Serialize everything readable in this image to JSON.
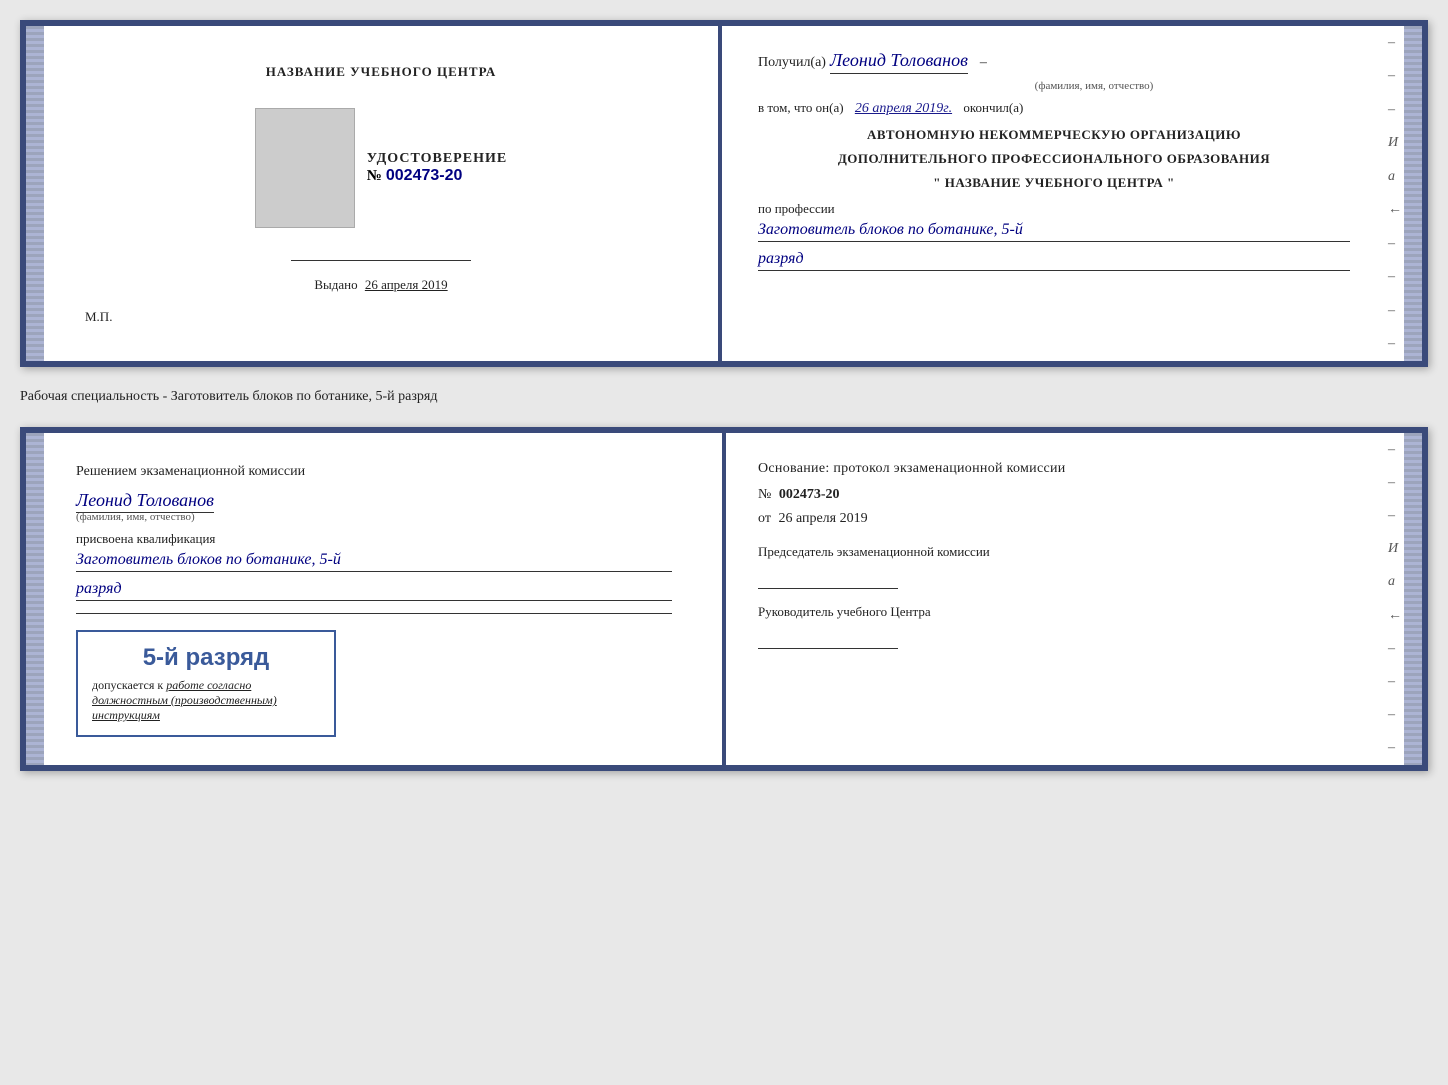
{
  "page": {
    "background": "#e8e8e8"
  },
  "certificate": {
    "left": {
      "title": "НАЗВАНИЕ УЧЕБНОГО ЦЕНТРА",
      "photo_alt": "фото",
      "udostoverenie_label": "УДОСТОВЕРЕНИЕ",
      "number_prefix": "№",
      "number": "002473-20",
      "issued_label": "Выдано",
      "issued_date": "26 апреля 2019",
      "mp_label": "М.П."
    },
    "right": {
      "received_prefix": "Получил(а)",
      "recipient_name": "Леонид Толованов",
      "fio_label": "(фамилия, имя, отчество)",
      "in_that_prefix": "в том, что он(а)",
      "in_that_date": "26 апреля 2019г.",
      "completed_suffix": "окончил(а)",
      "org_line1": "АВТОНОМНУЮ НЕКОММЕРЧЕСКУЮ ОРГАНИЗАЦИЮ",
      "org_line2": "ДОПОЛНИТЕЛЬНОГО ПРОФЕССИОНАЛЬНОГО ОБРАЗОВАНИЯ",
      "org_name": "\"  НАЗВАНИЕ УЧЕБНОГО ЦЕНТРА  \"",
      "profession_label": "по профессии",
      "profession_text": "Заготовитель блоков по ботанике, 5-й",
      "rank_text": "разряд"
    }
  },
  "specialty_label": "Рабочая специальность - Заготовитель блоков по ботанике, 5-й разряд",
  "exam": {
    "left": {
      "decision_prefix": "Решением экзаменационной комиссии",
      "recipient_name": "Леонид Толованов",
      "fio_label": "(фамилия, имя, отчество)",
      "assigned_label": "присвоена квалификация",
      "qualification_text": "Заготовитель блоков по ботанике, 5-й",
      "rank_text": "разряд",
      "stamp_rank": "5-й разряд",
      "stamp_admit_prefix": "допускается к",
      "stamp_admit_text": "работе согласно должностным (производственным) инструкциям"
    },
    "right": {
      "basis_label": "Основание: протокол экзаменационной комиссии",
      "number_prefix": "№",
      "number": "002473-20",
      "date_prefix": "от",
      "date": "26 апреля 2019",
      "chairman_label": "Председатель экзаменационной комиссии",
      "director_label": "Руководитель учебного Центра"
    }
  },
  "right_margin_dashes": [
    "-",
    "-",
    "-",
    "И",
    "a",
    "←",
    "-",
    "-",
    "-",
    "-",
    "-"
  ]
}
